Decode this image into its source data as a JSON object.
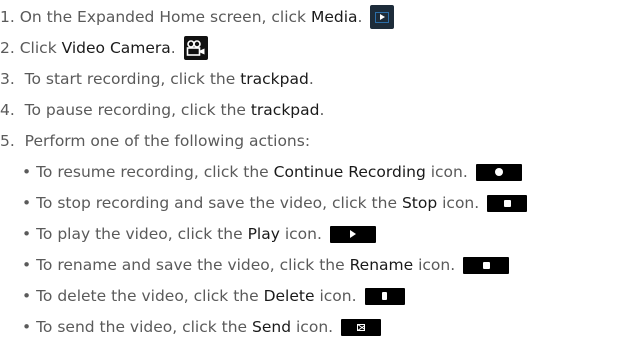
{
  "steps": [
    {
      "num": "1.",
      "text": "On the Expanded Home screen, click ",
      "bold": "Media",
      "tail": ".",
      "icon": "media-icon"
    },
    {
      "num": "2.",
      "text": "Click ",
      "bold": "Video Camera",
      "tail": ".",
      "icon": "video-camera-icon"
    },
    {
      "num": "3.",
      "text": "To start recording, click the ",
      "bold": "trackpad",
      "tail": "."
    },
    {
      "num": "4.",
      "text": "To pause recording, click the ",
      "bold": "trackpad",
      "tail": "."
    },
    {
      "num": "5.",
      "text": "Perform one of the following actions:"
    }
  ],
  "bullet": "•",
  "actions": [
    {
      "text": "To resume recording, click the ",
      "bold": "Continue Recording",
      "tail": " icon.",
      "icon": "continue-recording-icon"
    },
    {
      "text": "To stop recording and save the video, click the ",
      "bold": "Stop",
      "tail": " icon.",
      "icon": "stop-icon"
    },
    {
      "text": "To play the video, click the ",
      "bold": "Play",
      "tail": " icon.",
      "icon": "play-icon"
    },
    {
      "text": "To rename and save the video, click the ",
      "bold": "Rename",
      "tail": " icon.",
      "icon": "rename-icon"
    },
    {
      "text": "To delete the video, click the ",
      "bold": "Delete",
      "tail": " icon.",
      "icon": "delete-icon"
    },
    {
      "text": "To send the video, click the ",
      "bold": "Send",
      "tail": " icon.",
      "icon": "send-icon"
    }
  ],
  "colors": {
    "text": "#5a5a5a",
    "emphasis": "#1a1a1a",
    "icon_bg": "#000000",
    "media_bg": "#1d2c3a",
    "media_accent": "#2c6ea8"
  }
}
